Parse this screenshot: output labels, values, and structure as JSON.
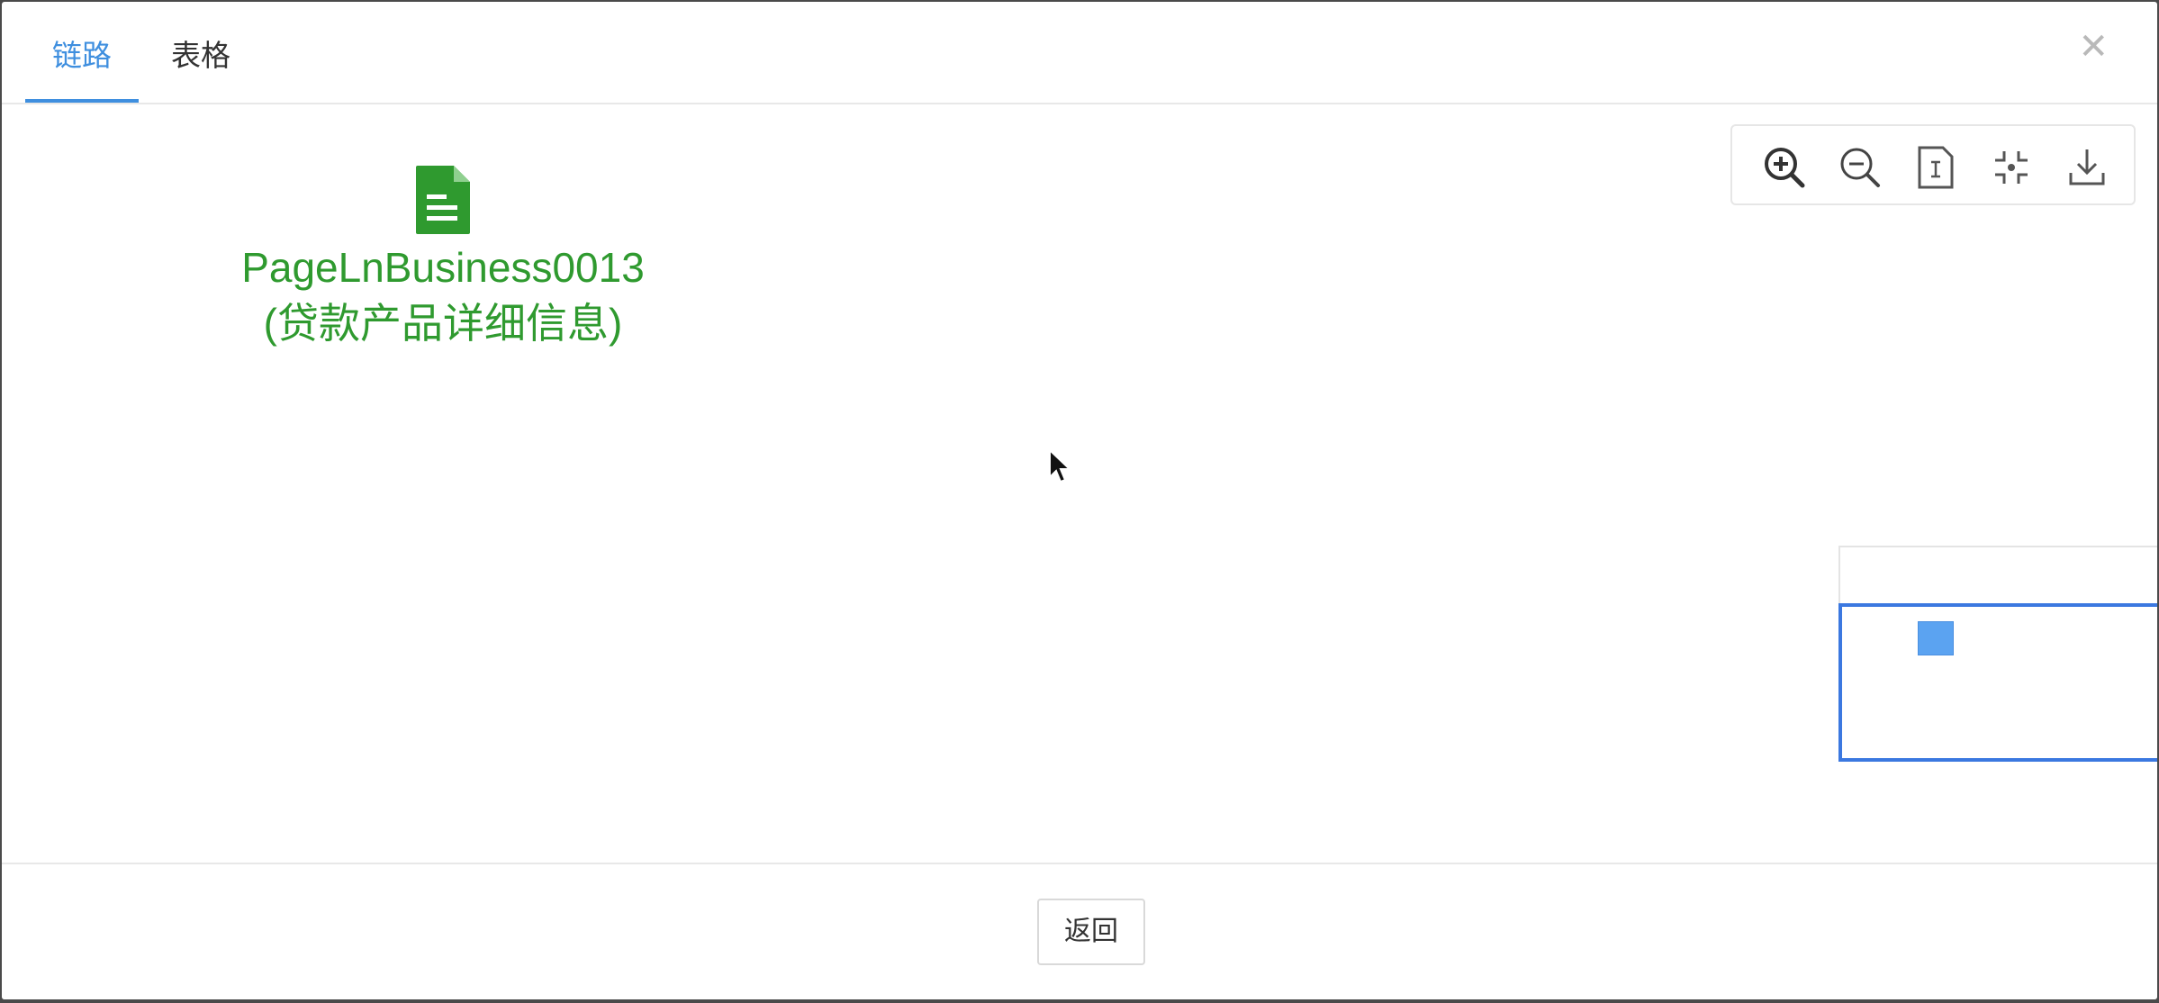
{
  "tabs": [
    {
      "label": "链路",
      "active": true
    },
    {
      "label": "表格",
      "active": false
    }
  ],
  "close_icon": "close-icon",
  "node": {
    "icon": "document-icon",
    "name": "PageLnBusiness0013",
    "description": "(贷款产品详细信息)",
    "color": "#2f9a2f"
  },
  "toolbar": {
    "buttons": [
      "zoom-in-icon",
      "zoom-out-icon",
      "fit-page-icon",
      "center-icon",
      "download-icon"
    ]
  },
  "minimap": {
    "border_color": "#3b78e0",
    "node_color": "#5ba3f1"
  },
  "footer": {
    "back_label": "返回"
  },
  "colors": {
    "accent": "#3f8fdf",
    "node_green": "#2f9a2f"
  }
}
